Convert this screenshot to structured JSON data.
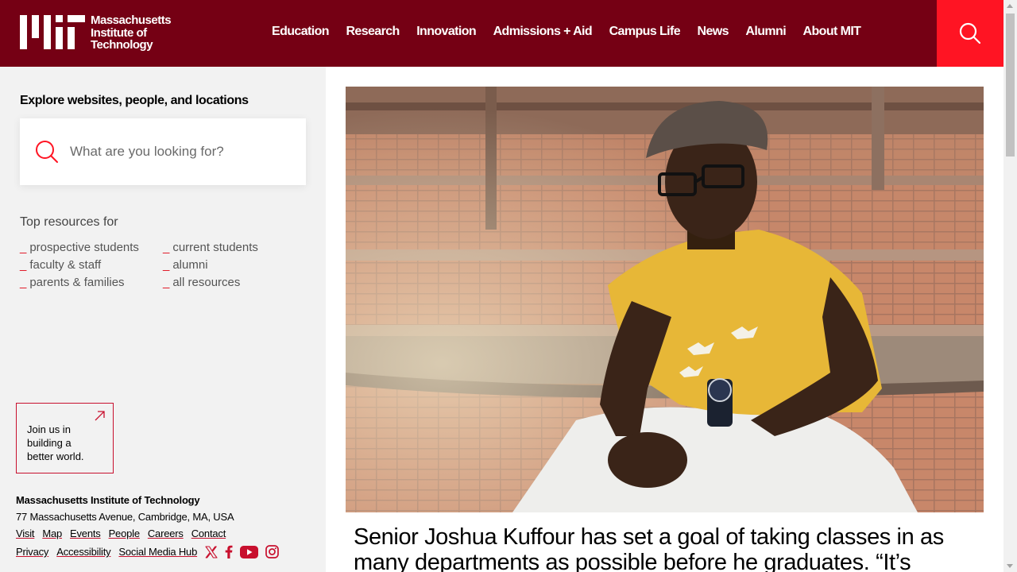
{
  "header": {
    "logo_lines": [
      "Massachusetts",
      "Institute of",
      "Technology"
    ],
    "nav": [
      "Education",
      "Research",
      "Innovation",
      "Admissions + Aid",
      "Campus Life",
      "News",
      "Alumni",
      "About MIT"
    ],
    "search_icon": "search-icon"
  },
  "sidebar": {
    "explore_title": "Explore websites, people, and locations",
    "search_placeholder": "What are you looking for?",
    "top_resources_label": "Top resources for",
    "resources": [
      "prospective students",
      "current students",
      "faculty & staff",
      "alumni",
      "parents & families",
      "all resources"
    ],
    "join_text": "Join us in building a better world.",
    "footer": {
      "name": "Massachusetts Institute of Technology",
      "address": "77 Massachusetts Avenue, Cambridge, MA, USA",
      "links_row1": [
        "Visit",
        "Map",
        "Events",
        "People",
        "Careers",
        "Contact"
      ],
      "links_row2": [
        "Privacy",
        "Accessibility",
        "Social Media Hub"
      ],
      "social": [
        "x-icon",
        "facebook-icon",
        "youtube-icon",
        "instagram-icon"
      ]
    }
  },
  "main": {
    "headline": "Senior Joshua Kuffour has set a goal of taking classes in as many departments as possible before he graduates. “It’s"
  },
  "colors": {
    "header_bg": "#750014",
    "accent_red": "#ff1423",
    "sidebar_bg": "#f2f2f2"
  }
}
